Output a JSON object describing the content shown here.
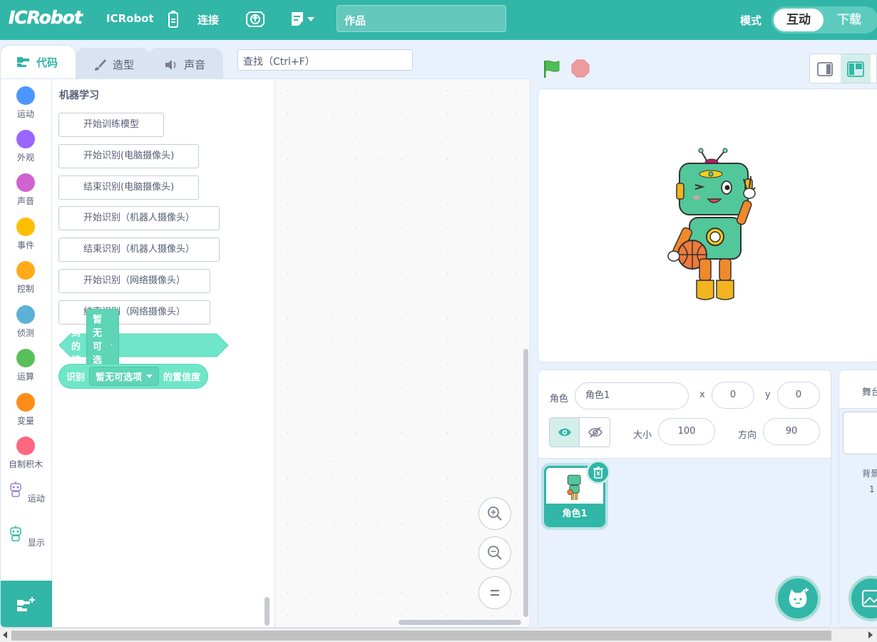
{
  "menubar": {
    "logo": "ICRobot",
    "brand": "ICRobot",
    "connect": "连接",
    "project_title": "作品",
    "mode_label": "模式",
    "mode_active": "互动",
    "mode_inactive": "下载"
  },
  "tabs": [
    {
      "label": "代码",
      "icon": "code-icon"
    },
    {
      "label": "造型",
      "icon": "brush-icon"
    },
    {
      "label": "声音",
      "icon": "speaker-icon"
    }
  ],
  "search": {
    "placeholder": "查找（Ctrl+F）"
  },
  "categories": [
    {
      "label": "运动",
      "color": "#4c97ff"
    },
    {
      "label": "外观",
      "color": "#9966ff"
    },
    {
      "label": "声音",
      "color": "#cf63cf"
    },
    {
      "label": "事件",
      "color": "#ffbf00"
    },
    {
      "label": "控制",
      "color": "#ffab19"
    },
    {
      "label": "侦测",
      "color": "#5cb1d6"
    },
    {
      "label": "运算",
      "color": "#59c059"
    },
    {
      "label": "变量",
      "color": "#ff8c1a"
    },
    {
      "label": "自制积木",
      "color": "#ff6680"
    },
    {
      "label": "运动",
      "icon": "robot-icon"
    },
    {
      "label": "显示",
      "icon": "robot-icon"
    }
  ],
  "palette": {
    "title": "机器学习",
    "buttons": [
      "开始训练模型",
      "开始识别(电脑摄像头)",
      "结束识别(电脑摄像头)",
      "开始识别（机器人摄像头）",
      "结束识别（机器人摄像头）",
      "开始识别（网络摄像头）",
      "结束识别（网络摄像头）"
    ],
    "hex_block": {
      "text": "识别到的结果为",
      "dropdown": "暂无可选项"
    },
    "round_block": {
      "prefix": "识别",
      "dropdown": "暂无可选项",
      "suffix": "的置信度"
    }
  },
  "sprite_info": {
    "sprite_label": "角色",
    "sprite_name": "角色1",
    "x_label": "x",
    "x_value": "0",
    "y_label": "y",
    "y_value": "0",
    "size_label": "大小",
    "size_value": "100",
    "direction_label": "方向",
    "direction_value": "90"
  },
  "sprite_list": [
    {
      "name": "角色1"
    }
  ],
  "stage_panel": {
    "title": "舞台",
    "backdrop_label": "背景",
    "backdrop_count": "1"
  },
  "colors": {
    "accent": "#31b6a7",
    "block_green": "#6fe6c8"
  }
}
